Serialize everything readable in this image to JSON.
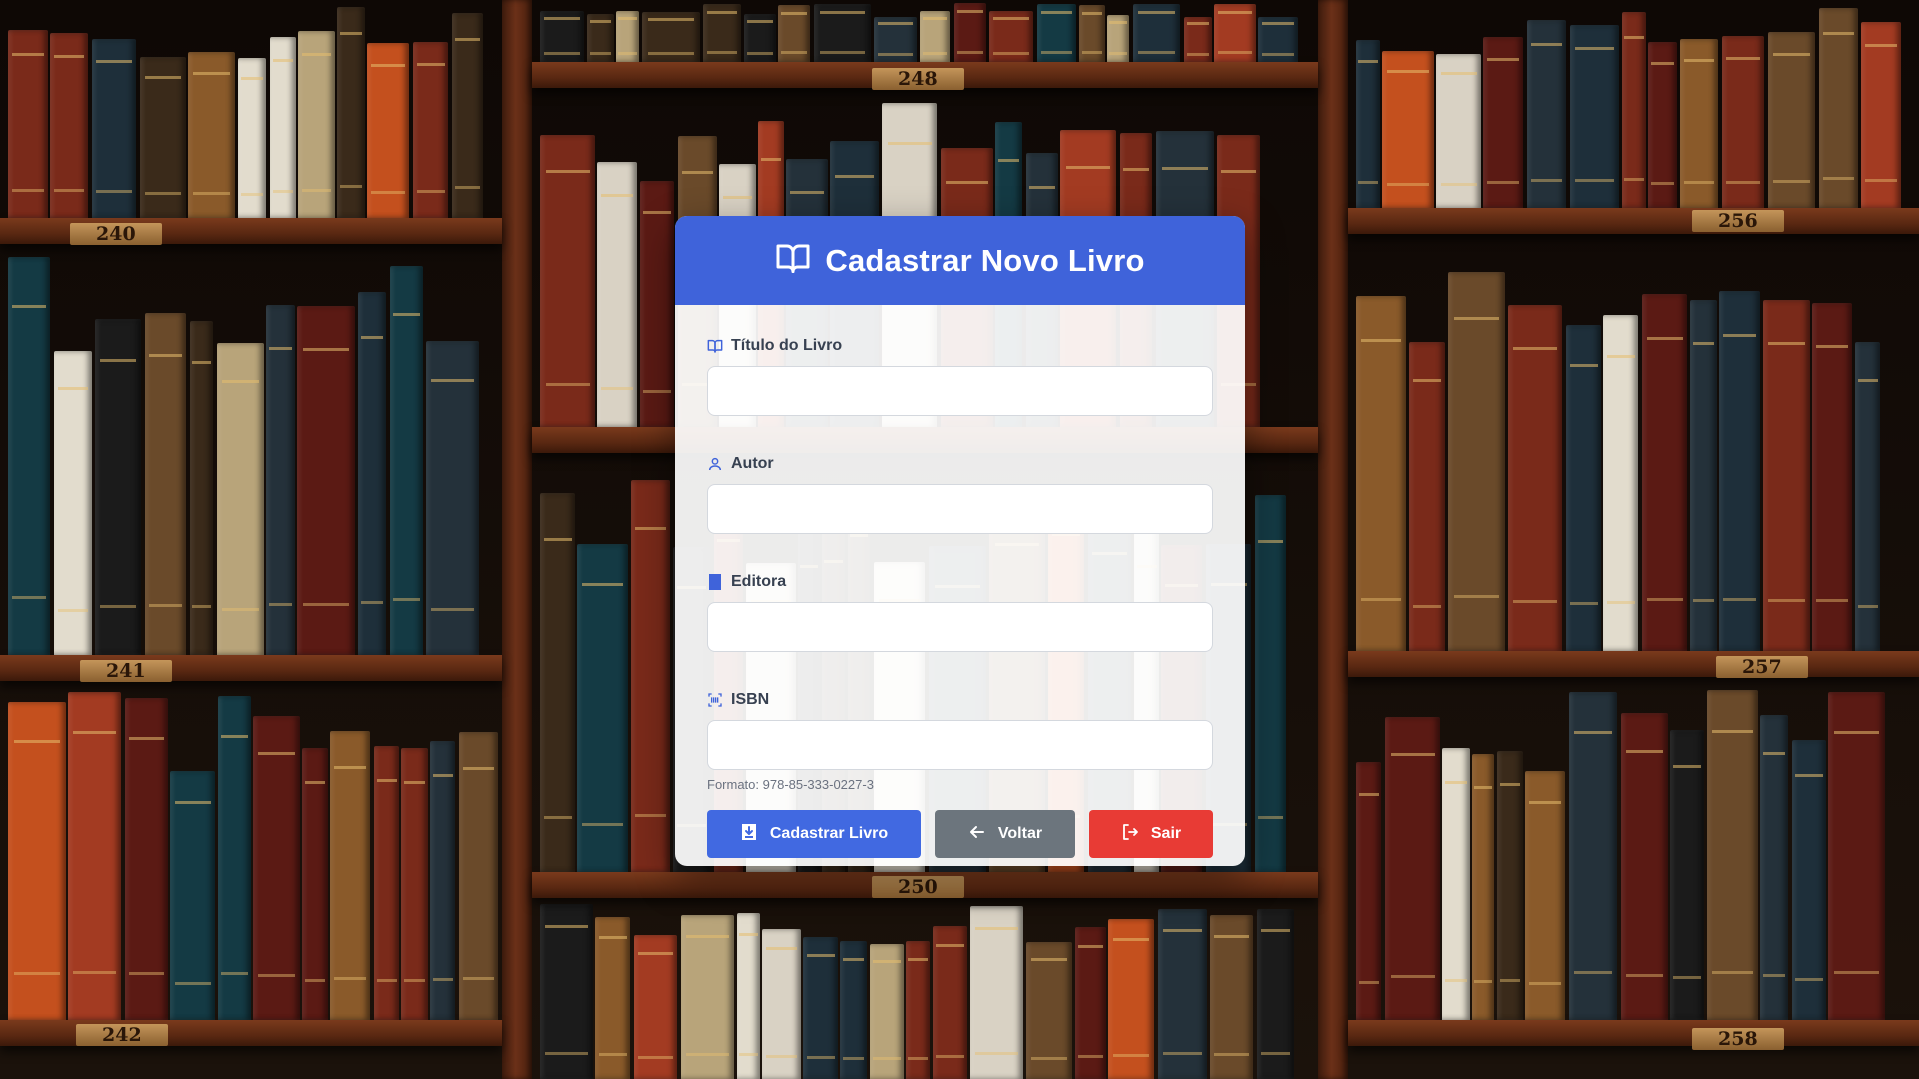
{
  "header": {
    "title": "Cadastrar Novo Livro"
  },
  "form": {
    "fields": [
      {
        "label": "Título do Livro",
        "value": "",
        "placeholder": ""
      },
      {
        "label": "Autor",
        "value": "",
        "placeholder": ""
      },
      {
        "label": "Editora",
        "value": "",
        "placeholder": ""
      },
      {
        "label": "ISBN",
        "value": "",
        "placeholder": ""
      }
    ],
    "isbn_hint": "Formato: 978-85-333-0227-3"
  },
  "actions": {
    "submit_label": "Cadastrar Livro",
    "back_label": "Voltar",
    "exit_label": "Sair"
  },
  "background": {
    "shelf_numbers": [
      "240",
      "248",
      "256",
      "241",
      "257",
      "250",
      "242",
      "258"
    ]
  },
  "colors": {
    "primary": "#3f63da",
    "secondary": "#6c757d",
    "danger": "#e83b35",
    "icon_blue": "#3f63da"
  }
}
